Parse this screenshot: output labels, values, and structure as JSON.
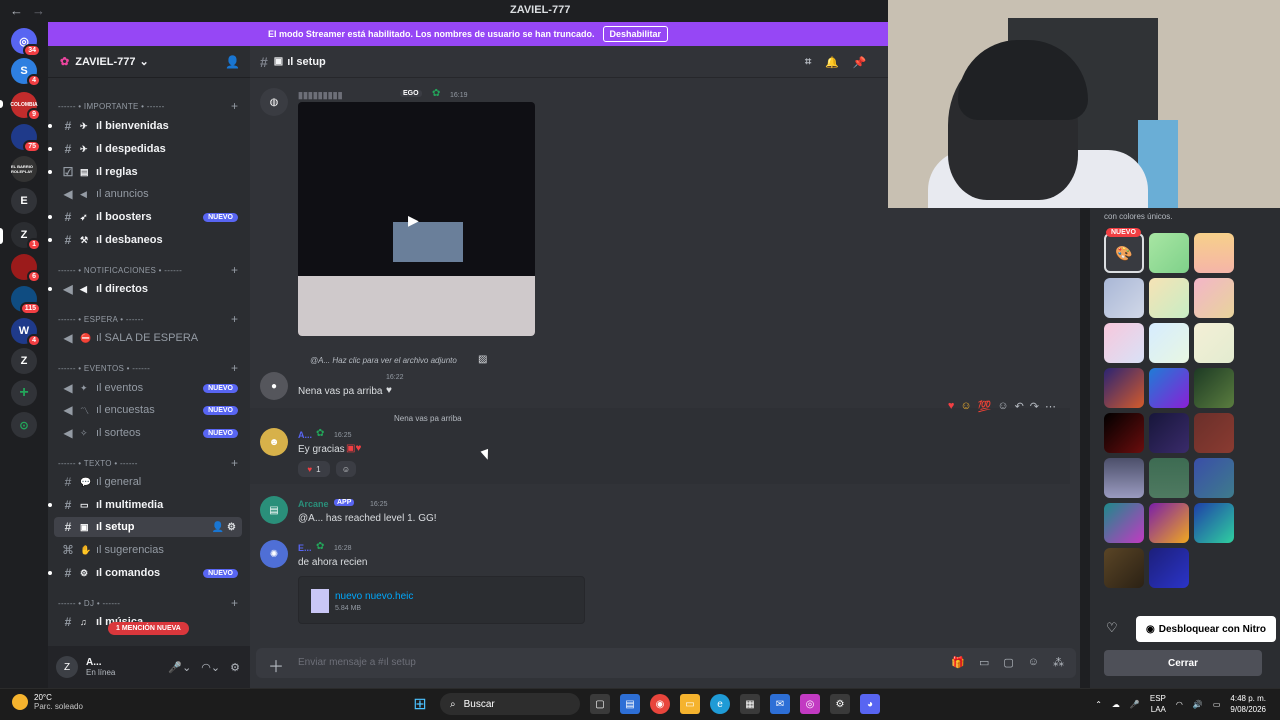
{
  "window": {
    "title": "ZAVIEL-777"
  },
  "streamer_banner": {
    "text": "El modo Streamer está habilitado. Los nombres de usuario se han truncado.",
    "button": "Deshabilitar"
  },
  "guilds": [
    {
      "label": "",
      "badge": "34",
      "color": "#5865f2"
    },
    {
      "label": "S",
      "badge": "4",
      "color": "#2e7fe0"
    },
    {
      "label": "COLOMBIA",
      "badge": "9",
      "color": "#c12c2c"
    },
    {
      "label": "",
      "badge": "75",
      "color": "#1f3a8a"
    },
    {
      "label": "EL BARRIO ROLEPLAY",
      "badge": "",
      "color": "#333"
    },
    {
      "label": "E",
      "badge": "",
      "color": "#313338"
    },
    {
      "label": "Z",
      "badge": "1",
      "color": "#2b2d31"
    },
    {
      "label": "",
      "badge": "6",
      "color": "#9b1b1b"
    },
    {
      "label": "",
      "badge": "115",
      "color": "#0f4c81"
    },
    {
      "label": "W",
      "badge": "4",
      "color": "#1f3a8a"
    },
    {
      "label": "Z",
      "badge": "",
      "color": "#313338"
    }
  ],
  "server": {
    "name": "ZAVIEL-777"
  },
  "categories": {
    "importante": "------ • IMPORTANTE • ------",
    "notificaciones": "------ • NOTIFICACIONES • ------",
    "espera": "------ • ESPERA • ------",
    "eventos": "------ • EVENTOS • ------",
    "texto": "------ • TEXTO • ------",
    "dj": "------ • DJ • ------"
  },
  "channels": {
    "bienvenidas": "ıl bienvenidas",
    "despedidas": "ıl despedidas",
    "reglas": "ıl reglas",
    "anuncios": "ıl anuncios",
    "boosters": "ıl boosters",
    "desbaneos": "ıl desbaneos",
    "directos": "ıl directos",
    "sala": "ıl SALA DE ESPERA",
    "eventos": "ıl eventos",
    "encuestas": "ıl encuestas",
    "sorteos": "ıl sorteos",
    "general": "ıl general",
    "multimedia": "ıl multimedia",
    "setup": "ıl setup",
    "sugerencias": "ıl sugerencias",
    "comandos": "ıl comandos",
    "musica": "ıl música"
  },
  "badges": {
    "nuevo": "NUEVO"
  },
  "mention_pill": "1 MENCIÓN NUEVA",
  "user": {
    "name": "A...",
    "status": "En línea",
    "avatar": "Z"
  },
  "channel_header": {
    "name": "ıl setup"
  },
  "messages": {
    "m1": {
      "tag": "EGO",
      "time": "16:19"
    },
    "reply1": "@A... Haz clic para ver el archivo adjunto",
    "m2": {
      "time": "16:22",
      "text": "Nena vas pa arriba"
    },
    "reply2": "Nena vas pa arriba",
    "m3": {
      "name": "A...",
      "time": "16:25",
      "text": "Ey gracias",
      "reaction_count": "1"
    },
    "m4": {
      "name": "Arcane",
      "tag": "APP",
      "time": "16:25",
      "text": "@A... has reached level 1. GG!"
    },
    "m5": {
      "name": "E...",
      "time": "16:28",
      "text": "de ahora recien"
    },
    "file": {
      "name": "nuevo nuevo.heic",
      "size": "5.84 MB"
    }
  },
  "composer": {
    "placeholder": "Enviar mensaje a #ıl setup"
  },
  "panel": {
    "subtitle": "con colores únicos.",
    "nuevo": "NUEVO",
    "nitro_button": "Desbloquear con Nitro",
    "close_button": "Cerrar"
  },
  "taskbar": {
    "temp": "20°C",
    "weather": "Parc. soleado",
    "search": "Buscar",
    "lang1": "ESP",
    "lang2": "LAA",
    "time": "4:48 p. m.",
    "date": "9/08/2026"
  }
}
